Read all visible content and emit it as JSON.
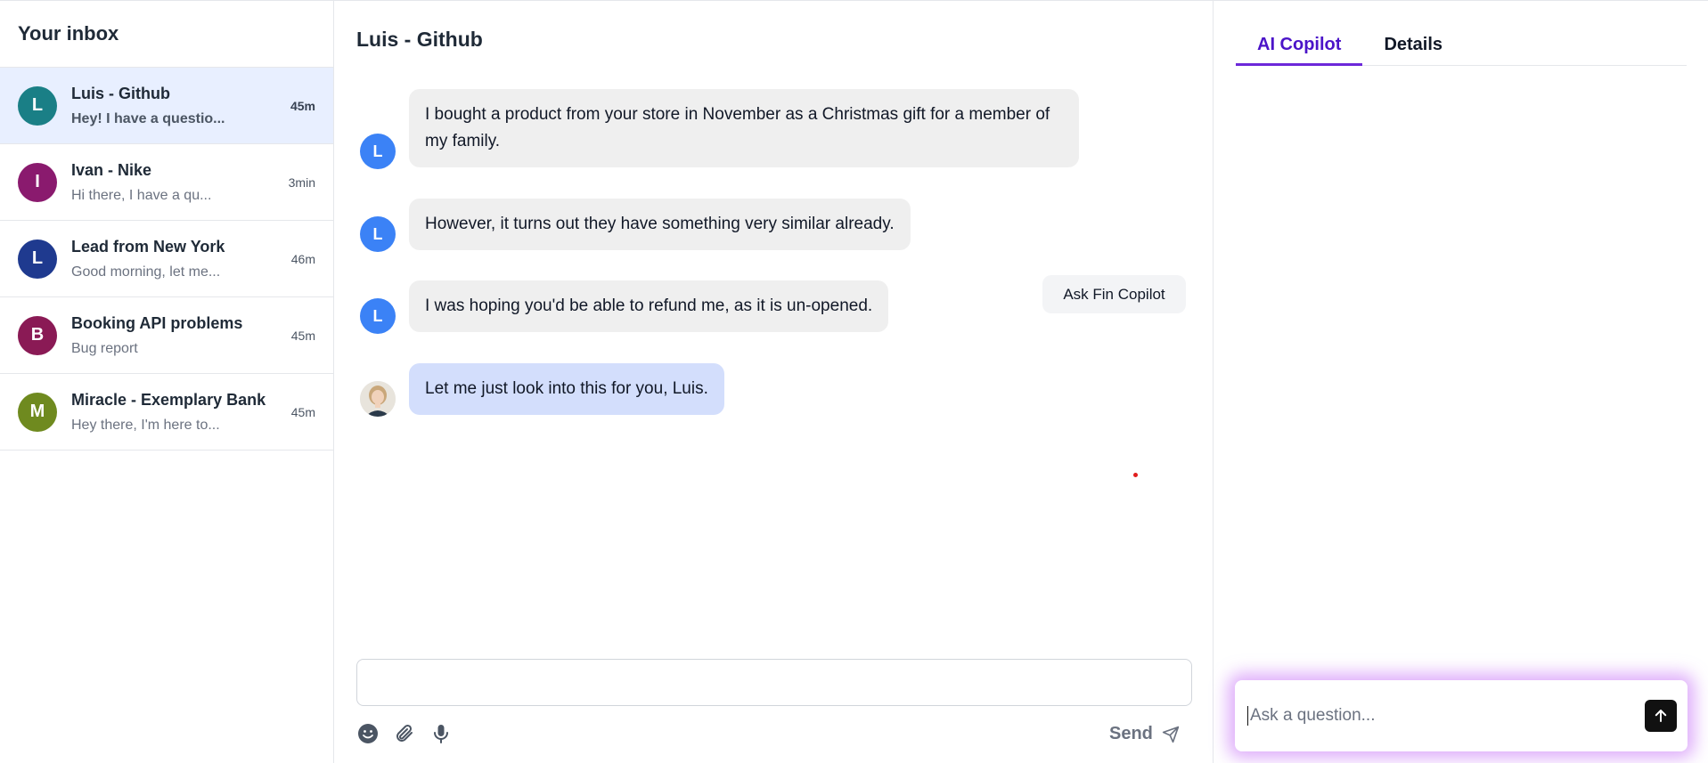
{
  "inbox": {
    "title": "Your inbox",
    "conversations": [
      {
        "initial": "L",
        "name": "Luis - Github",
        "preview": "Hey! I have a questio...",
        "time": "45m",
        "color": "#1a7f86"
      },
      {
        "initial": "I",
        "name": "Ivan - Nike",
        "preview": "Hi there, I have a qu...",
        "time": "3min",
        "color": "#8a1a6e"
      },
      {
        "initial": "L",
        "name": "Lead from New York",
        "preview": "Good morning, let me...",
        "time": "46m",
        "color": "#1f3a8f"
      },
      {
        "initial": "B",
        "name": "Booking API problems",
        "preview": "Bug report",
        "time": "45m",
        "color": "#8a1a55"
      },
      {
        "initial": "M",
        "name": "Miracle - Exemplary Bank",
        "preview": "Hey there, I'm here to...",
        "time": "45m",
        "color": "#6f8a1f"
      }
    ]
  },
  "chat": {
    "title": "Luis - Github",
    "messages": [
      {
        "avatar": "L",
        "text": "I bought a product from your store in November as a Christmas gift for a member of my family."
      },
      {
        "avatar": "L",
        "text": "However, it turns out they have something very similar already."
      },
      {
        "avatar": "L",
        "text": "I was hoping you'd be able to refund me, as it is un-opened."
      },
      {
        "avatar": "",
        "text": "Let me just look into this for you, Luis."
      }
    ],
    "ask_fin_label": "Ask Fin Copilot",
    "composer_value": "",
    "send_label": "Send",
    "tool_icons": [
      "emoji-icon",
      "paperclip-icon",
      "microphone-icon"
    ]
  },
  "copilot": {
    "tabs": [
      "AI Copilot",
      "Details"
    ],
    "active_tab": "AI Copilot",
    "ask_placeholder": "Ask a question...",
    "accent": "#6d28d9"
  }
}
